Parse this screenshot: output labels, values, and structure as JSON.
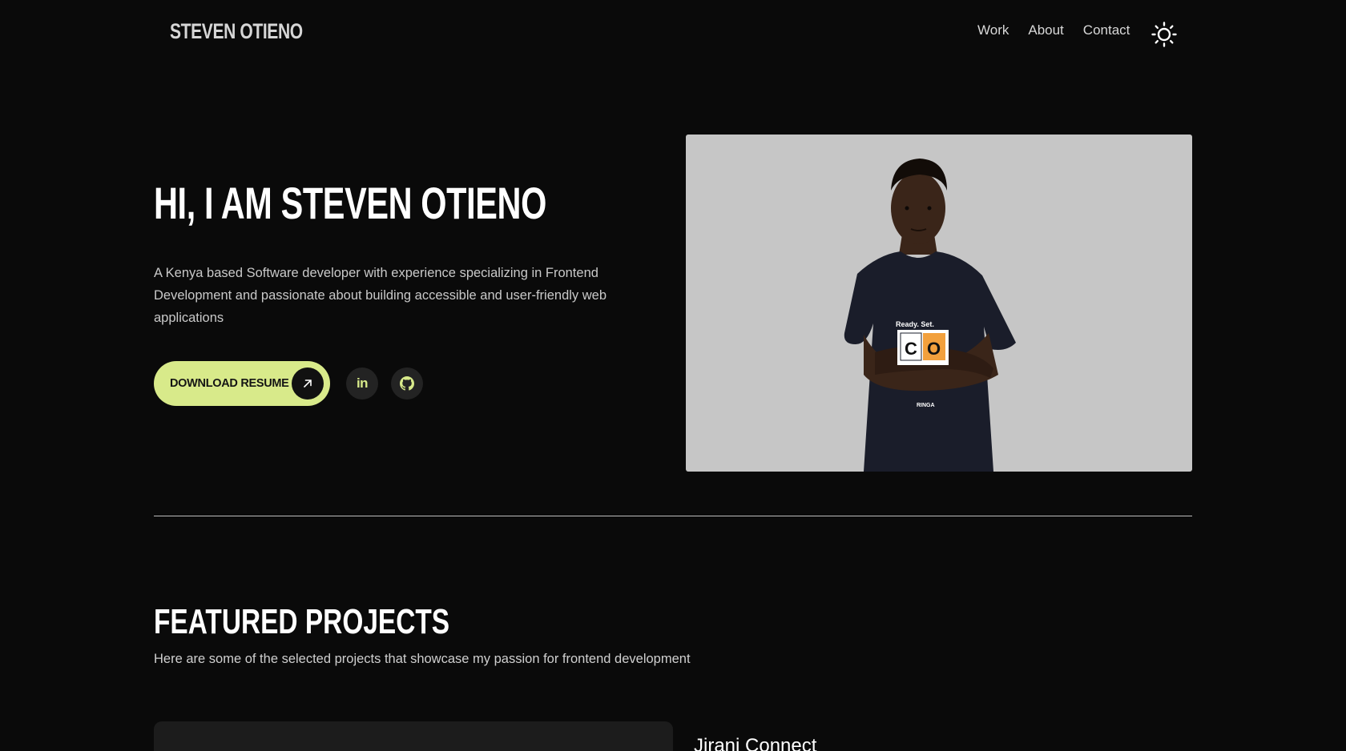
{
  "header": {
    "logo": "STEVEN OTIENO",
    "nav": [
      {
        "label": "Work"
      },
      {
        "label": "About"
      },
      {
        "label": "Contact"
      }
    ],
    "theme_toggle_icon": "sun-icon"
  },
  "hero": {
    "title": "HI, I AM STEVEN OTIENO",
    "description": "A Kenya based Software developer with experience specializing in Frontend Development and passionate about building accessible and user-friendly web applications",
    "resume_button": {
      "label": "DOWNLOAD RESUME",
      "icon": "arrow-up-right-icon"
    },
    "socials": [
      {
        "name": "linkedin",
        "icon": "linkedin-icon",
        "text": "in"
      },
      {
        "name": "github",
        "icon": "github-icon"
      }
    ],
    "portrait": {
      "shirt_top": "Ready. Set.",
      "shirt_letters": [
        "C",
        "O"
      ],
      "shirt_bottom": "RINGA"
    }
  },
  "featured": {
    "title": "FEATURED PROJECTS",
    "subtitle": "Here are some of the selected projects that showcase my passion for frontend development",
    "projects": [
      {
        "name": "Jirani Connect"
      }
    ]
  },
  "colors": {
    "background": "#0a0a0a",
    "accent": "#d8ea8a",
    "text": "#ffffff",
    "muted": "#c9c9c9",
    "photo_bg": "#c6c6c6"
  }
}
